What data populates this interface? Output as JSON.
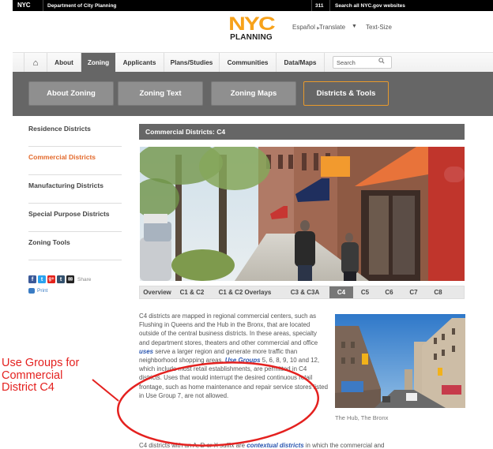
{
  "topbar": {
    "logo": "NYC",
    "department": "Department of City Planning",
    "hotline": "311",
    "search_all": "Search all NYC.gov websites"
  },
  "header": {
    "logo_top": "NYC",
    "logo_bottom": "PLANNING",
    "espanol": "Español",
    "translate": "Translate",
    "translate_arrow": "▼",
    "text_size": "Text-Size"
  },
  "main_nav": {
    "home_icon": "⌂",
    "items": [
      {
        "label": "About"
      },
      {
        "label": "Zoning",
        "active": true
      },
      {
        "label": "Applicants"
      },
      {
        "label": "Plans/Studies"
      },
      {
        "label": "Communities"
      },
      {
        "label": "Data/Maps"
      }
    ],
    "search_placeholder": "Search",
    "search_icon": "⚲"
  },
  "sub_nav": {
    "items": [
      {
        "label": "About Zoning"
      },
      {
        "label": "Zoning Text"
      },
      {
        "label": "Zoning Maps"
      },
      {
        "label": "Districts & Tools",
        "active": true
      }
    ],
    "active_border_color": "#e89a2c"
  },
  "sidebar": {
    "items": [
      {
        "label": "Residence Districts"
      },
      {
        "label": "Commercial Districts",
        "active": true
      },
      {
        "label": "Manufacturing Districts"
      },
      {
        "label": "Special Purpose Districts"
      },
      {
        "label": "Zoning Tools"
      }
    ],
    "share": {
      "icons": [
        {
          "name": "facebook",
          "glyph": "f",
          "color": "#3b5998"
        },
        {
          "name": "twitter",
          "glyph": "t",
          "color": "#2aa3ef"
        },
        {
          "name": "google-plus",
          "glyph": "g+",
          "color": "#e3231c"
        },
        {
          "name": "tumblr",
          "glyph": "t",
          "color": "#34526f"
        },
        {
          "name": "email",
          "glyph": "✉",
          "color": "#222222"
        }
      ],
      "label": "Share"
    },
    "print_label": "Print",
    "active_color": "#e3692b"
  },
  "content": {
    "title": "Commercial Districts: C4",
    "hero_alt": "Street scene with shops, awnings and trees in a commercial district",
    "tabs": [
      {
        "label": "Overview"
      },
      {
        "label": "C1 & C2"
      },
      {
        "label": "C1 & C2 Overlays"
      },
      {
        "label": "C3 & C3A"
      },
      {
        "label": "C4",
        "active": true
      },
      {
        "label": "C5"
      },
      {
        "label": "C6"
      },
      {
        "label": "C7"
      },
      {
        "label": "C8"
      }
    ],
    "paragraph1": {
      "part1": "C4 districts are mapped in regional commercial centers, such as Flushing in Queens and the Hub in the Bronx, that are located outside of the central business districts. In these areas, specialty and department stores, theaters and other commercial and office ",
      "link1": "uses",
      "part2": " serve a larger region and generate more traffic than neighborhood shopping areas. ",
      "link2": "Use Groups",
      "part3": " 5, 6, 8, 9, 10 and 12, which include most retail establishments, are permitted in C4 districts. Uses that would interrupt the desired continuous retail frontage, such as home maintenance and repair service stores listed in Use Group 7, are not allowed."
    },
    "paragraph2": {
      "part1": "C4 districts with an A, D or X suffix are ",
      "link1": "contextual districts",
      "part2": " in which the commercial and"
    },
    "side_photo_caption": "The Hub, The Bronx",
    "link_color": "#2a56b0"
  },
  "annotation": {
    "text_line1": "Use Groups for",
    "text_line2": "Commercial",
    "text_line3": "District C4",
    "color": "#e4211f"
  }
}
